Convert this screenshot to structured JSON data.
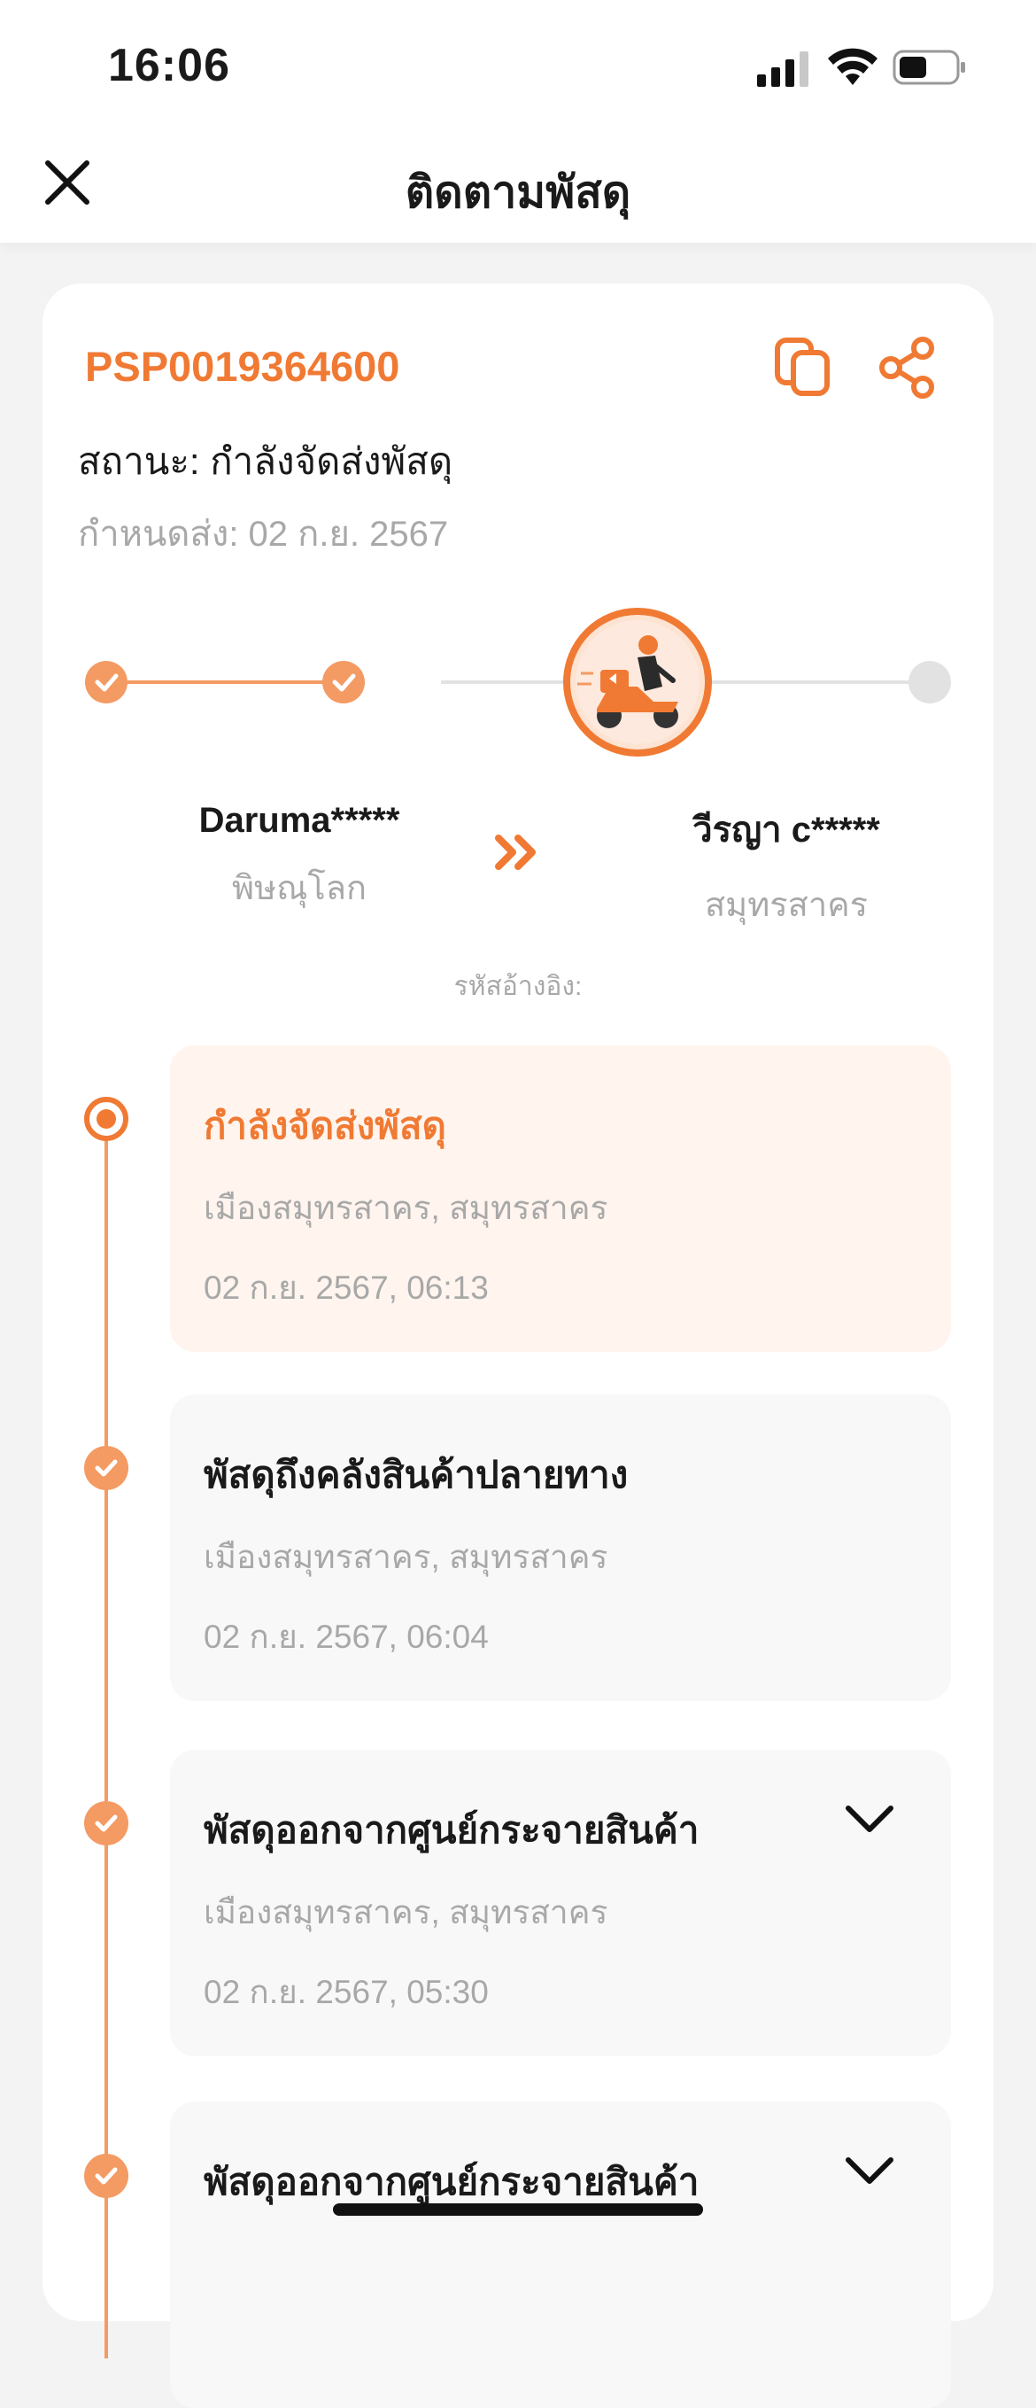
{
  "status_bar": {
    "time": "16:06",
    "icons": [
      "signal-icon",
      "wifi-icon",
      "battery-icon"
    ]
  },
  "nav": {
    "title": "ติดตามพัสดุ",
    "close_icon": "close-icon"
  },
  "parcel": {
    "tracking_number": "PSP0019364600",
    "status": "สถานะ: กำลังจัดส่งพัสดุ",
    "due": "กำหนดส่ง: 02 ก.ย. 2567",
    "progress_steps_done": 2,
    "progress_current_step": 3,
    "progress_total_steps": 4
  },
  "sender": {
    "name": "Daruma*****",
    "city": "พิษณุโลก"
  },
  "receiver": {
    "name": "วีรญา c*****",
    "city": "สมุทรสาคร"
  },
  "reference_label": "รหัสอ้างอิง:",
  "events": [
    {
      "title": "กำลังจัดส่งพัสดุ",
      "location": "เมืองสมุทรสาคร, สมุทรสาคร",
      "time": "02 ก.ย. 2567, 06:13"
    },
    {
      "title": "พัสดุถึงคลังสินค้าปลายทาง",
      "location": "เมืองสมุทรสาคร, สมุทรสาคร",
      "time": "02 ก.ย. 2567, 06:04"
    },
    {
      "title": "พัสดุออกจากศูนย์กระจายสินค้า",
      "location": "เมืองสมุทรสาคร, สมุทรสาคร",
      "time": "02 ก.ย. 2567, 05:30"
    },
    {
      "title": "พัสดุออกจากศูนย์กระจายสินค้า"
    }
  ],
  "colors": {
    "accent": "#f07a33",
    "accent_light": "#f49a63",
    "muted": "#a8a8a8",
    "active_bg": "#fff4ee"
  }
}
